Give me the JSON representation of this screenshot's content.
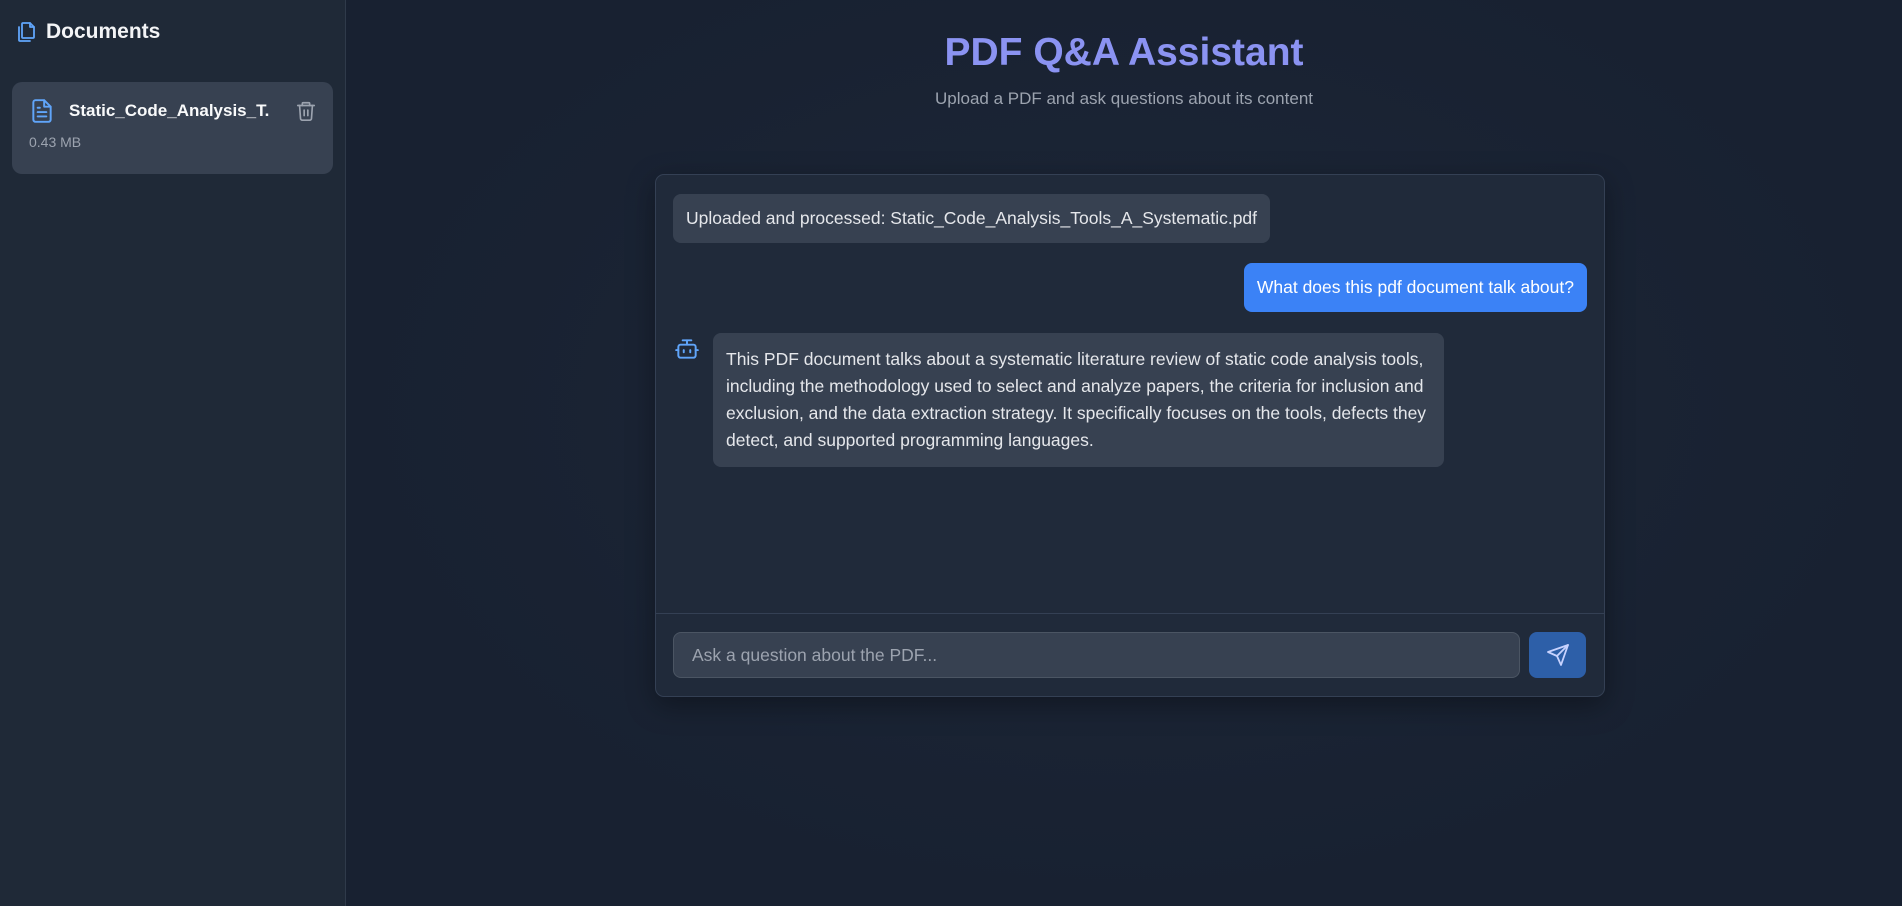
{
  "sidebar": {
    "title": "Documents",
    "title_icon": "documents-icon",
    "documents": [
      {
        "name": "Static_Code_Analysis_T...",
        "size": "0.43 MB",
        "icon": "file-text-icon",
        "action_icon": "trash-icon"
      }
    ]
  },
  "header": {
    "title": "PDF Q&A Assistant",
    "subtitle": "Upload a PDF and ask questions about its content"
  },
  "chat": {
    "messages": [
      {
        "role": "system",
        "text": "Uploaded and processed: Static_Code_Analysis_Tools_A_Systematic.pdf"
      },
      {
        "role": "user",
        "text": "What does this pdf document talk about?"
      },
      {
        "role": "assistant",
        "icon": "bot-icon",
        "text": "This PDF document talks about a systematic literature review of static code analysis tools, including the methodology used to select and analyze papers, the criteria for inclusion and exclusion, and the data extraction strategy. It specifically focuses on the tools, defects they detect, and supported programming languages."
      }
    ],
    "input": {
      "placeholder": "Ask a question about the PDF...",
      "value": ""
    },
    "send_icon": "send-icon"
  },
  "colors": {
    "accent": "#8b93f2",
    "user_bubble": "#3b82f6",
    "send_button": "#2d5fa8",
    "icon_blue": "#60a5fa"
  }
}
